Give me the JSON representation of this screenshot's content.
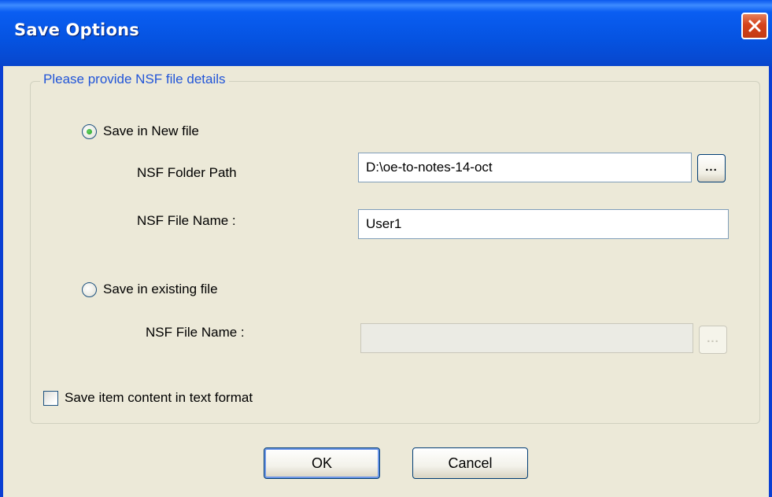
{
  "window": {
    "title": "Save Options",
    "close_glyph": "✕"
  },
  "group": {
    "legend": "Please provide NSF file details"
  },
  "new_file": {
    "radio_label": "Save in New file",
    "selected": true,
    "folder_path_label": "NSF Folder Path",
    "folder_path_value": "D:\\oe-to-notes-14-oct",
    "browse_label": "...",
    "file_name_label": "NSF File Name :",
    "file_name_value": "User1"
  },
  "existing_file": {
    "radio_label": "Save in existing file",
    "selected": false,
    "file_name_label": "NSF File Name :",
    "file_name_value": "",
    "browse_label": "..."
  },
  "text_format": {
    "label": "Save item content in text format",
    "checked": false
  },
  "buttons": {
    "ok": "OK",
    "cancel": "Cancel"
  },
  "colors": {
    "title_bar": "#0553e1",
    "legend_text": "#2155d8",
    "close_button": "#d4421c",
    "window_bg": "#ece9d8"
  }
}
